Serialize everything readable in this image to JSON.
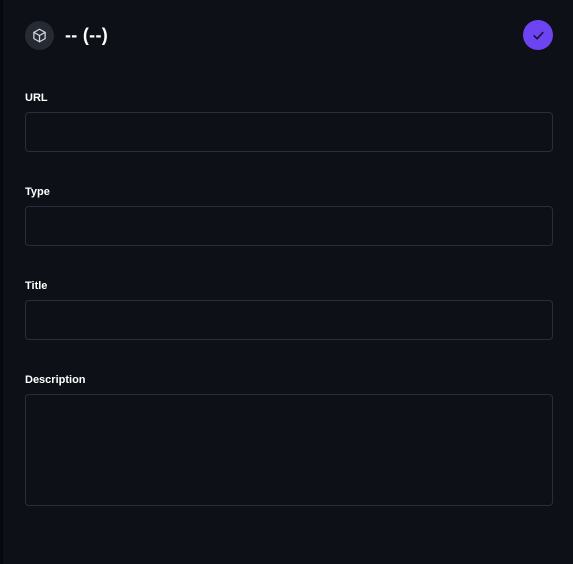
{
  "header": {
    "icon": "box-icon",
    "title": "-- (--)",
    "confirm_icon": "check-icon",
    "accent_color": "#6d44f2"
  },
  "form": {
    "url": {
      "label": "URL",
      "value": "",
      "placeholder": ""
    },
    "type": {
      "label": "Type",
      "value": "",
      "placeholder": ""
    },
    "title": {
      "label": "Title",
      "value": "",
      "placeholder": ""
    },
    "description": {
      "label": "Description",
      "value": "",
      "placeholder": ""
    }
  }
}
